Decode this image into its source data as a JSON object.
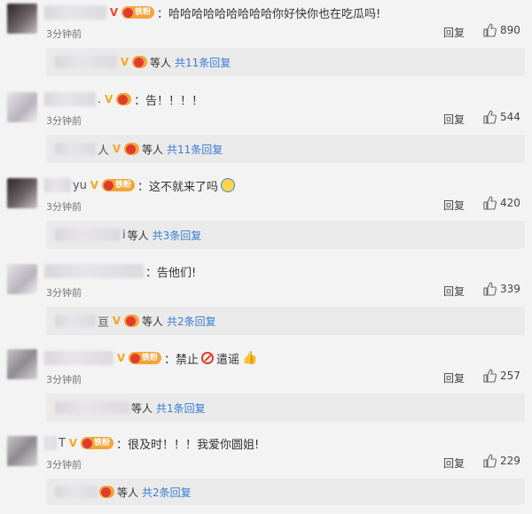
{
  "labels": {
    "reply": "回复",
    "others": "等人"
  },
  "icons": {
    "like": "thumbs-up-icon",
    "verified": "v-badge-icon",
    "fan_badge": "heart-fan-badge-icon"
  },
  "colors": {
    "link": "#3a7bd5",
    "fan_badge_bg": "#f3a43b",
    "v_orange": "#f5a623",
    "v_red": "#e8462c"
  },
  "fan_badge_text": "铁粉",
  "comments": [
    {
      "name_tail": "",
      "text": "：哈哈哈哈哈哈哈哈哈你好快你也在吃瓜吗!",
      "time": "3分钟前",
      "likes": "890",
      "sub": {
        "name_tail": "",
        "others": "等人",
        "link": "共11条回复"
      }
    },
    {
      "name_tail": ".",
      "text": "：告！！！！",
      "time": "3分钟前",
      "likes": "544",
      "sub": {
        "name_tail": "人",
        "others": "等人",
        "link": "共11条回复"
      }
    },
    {
      "name_tail": "yu",
      "text": "：这不就来了吗",
      "time": "3分钟前",
      "likes": "420",
      "sub": {
        "name_tail": "i",
        "others": "等人",
        "link": "共3条回复"
      }
    },
    {
      "name_tail": "",
      "text": "：告他们!",
      "time": "3分钟前",
      "likes": "339",
      "sub": {
        "name_tail": "亘",
        "others": "等人",
        "link": "共2条回复"
      }
    },
    {
      "name_tail": "",
      "text": "：禁止",
      "text2": "遣谣",
      "time": "3分钟前",
      "likes": "257",
      "sub": {
        "name_tail": "",
        "others": "等人",
        "link": "共1条回复"
      }
    },
    {
      "name_tail": "T",
      "text": "：很及时！！！我爱你圆姐!",
      "time": "3分钟前",
      "likes": "229",
      "sub": {
        "name_tail": "",
        "others": "等人",
        "link": "共2条回复"
      }
    }
  ]
}
